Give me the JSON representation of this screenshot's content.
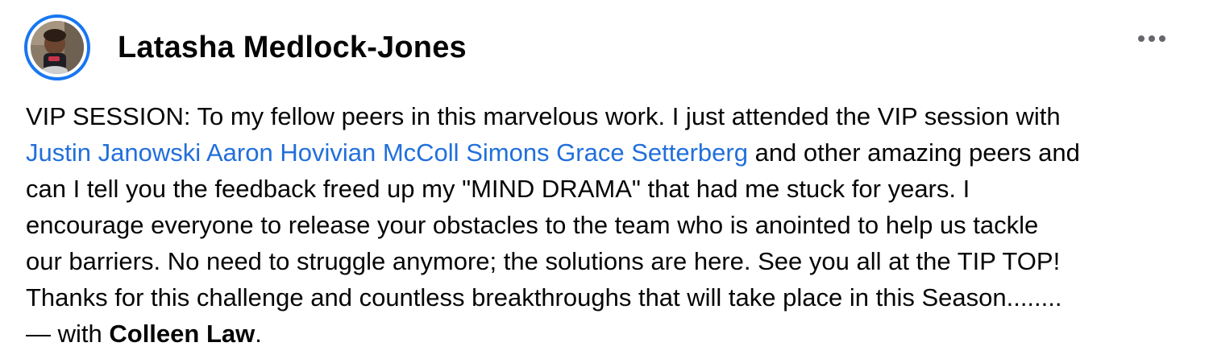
{
  "post": {
    "author_name": "Latasha Medlock-Jones",
    "accent_color": "#1877f2",
    "link_color": "#216fdb",
    "menu_icon": "more-horizontal-icon",
    "lines": {
      "l1": "VIP SESSION: To my fellow peers in this marvelous work. I just attended the VIP session with",
      "l2_tagged_1": "Justin Janowski",
      "l2_tagged_2": "Aaron Hovivian McColl",
      "l2_tagged_3": "Simons Grace Setterberg",
      "l2_rest": "and other amazing peers and",
      "l3": "can I tell you the feedback freed up my \"MIND DRAMA\" that had me stuck for years.  I",
      "l4": "encourage everyone to release your obstacles to the team who is anointed to help us tackle",
      "l5": "our barriers. No need to struggle anymore; the solutions are here. See you all at the TIP TOP!",
      "l6": "Thanks for this challenge and countless breakthroughs that will take place in this Season........",
      "with_prefix": "— with",
      "with_name": "Colleen Law",
      "with_suffix": "."
    }
  }
}
